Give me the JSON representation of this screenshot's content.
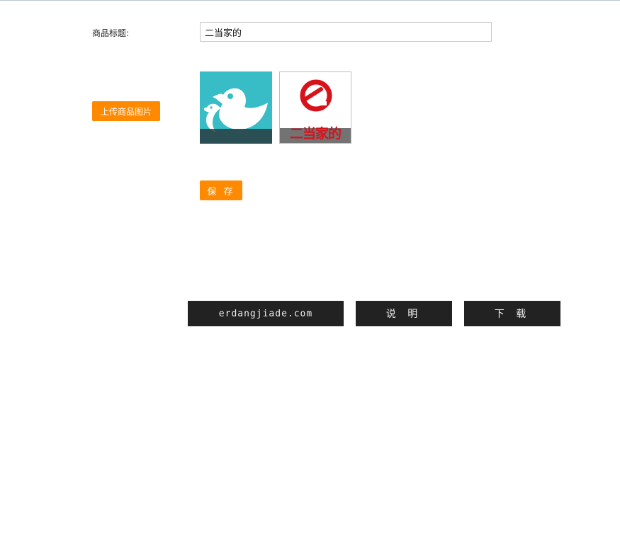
{
  "form": {
    "title_label": "商品标题:",
    "title_value": "二当家的",
    "upload_label": "上传商品图片",
    "save_label": "保 存"
  },
  "images": [
    {
      "icon": "bird-icon"
    },
    {
      "icon": "erdangjia-logo",
      "logo_text": "二当家的"
    }
  ],
  "footer": {
    "site_link": "erdangjiade.com",
    "help_label": "说 明",
    "download_label": "下 载"
  },
  "colors": {
    "accent": "#ff8a00",
    "dark_button": "#222222",
    "thumb_teal": "#38bcc6",
    "logo_red": "#d8121a"
  }
}
